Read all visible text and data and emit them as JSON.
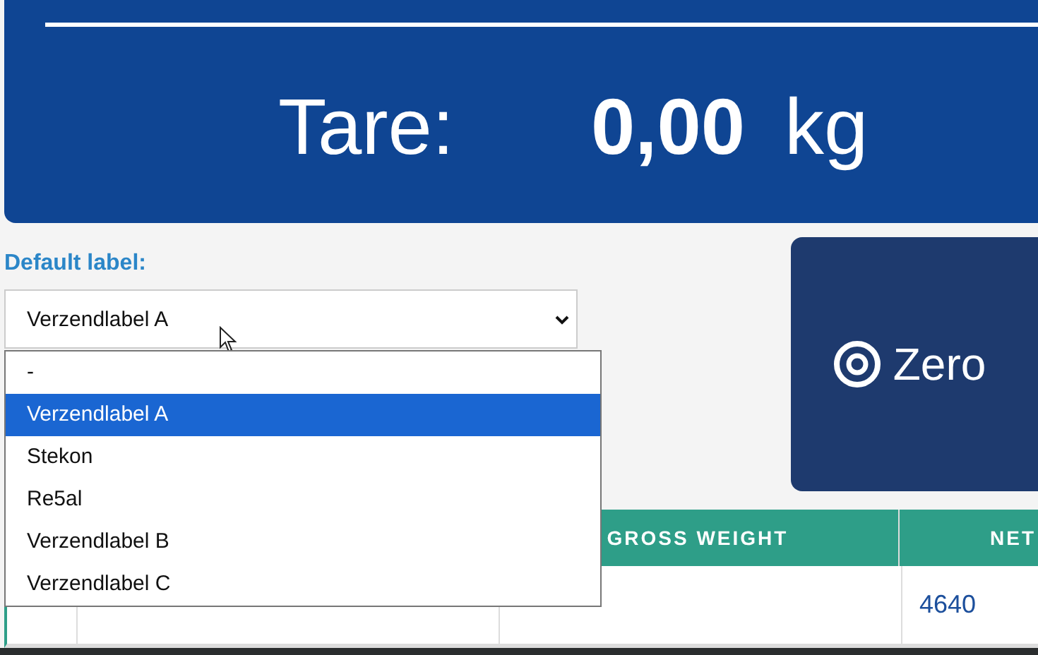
{
  "tare": {
    "label": "Tare:",
    "value": "0,00",
    "unit": "kg"
  },
  "default_label": {
    "label": "Default label:",
    "value": "Verzendlabel A",
    "expanded": true,
    "options": [
      {
        "label": "-",
        "selected": false
      },
      {
        "label": "Verzendlabel A",
        "selected": true
      },
      {
        "label": "Stekon",
        "selected": false
      },
      {
        "label": "Re5al",
        "selected": false
      },
      {
        "label": "Verzendlabel B",
        "selected": false
      },
      {
        "label": "Verzendlabel C",
        "selected": false
      }
    ]
  },
  "zero_button": {
    "label": "Zero"
  },
  "table": {
    "columns": [
      "",
      "",
      "GROSS WEIGHT",
      "NET"
    ],
    "rows": [
      [
        "",
        "",
        "",
        "4640"
      ]
    ]
  }
}
